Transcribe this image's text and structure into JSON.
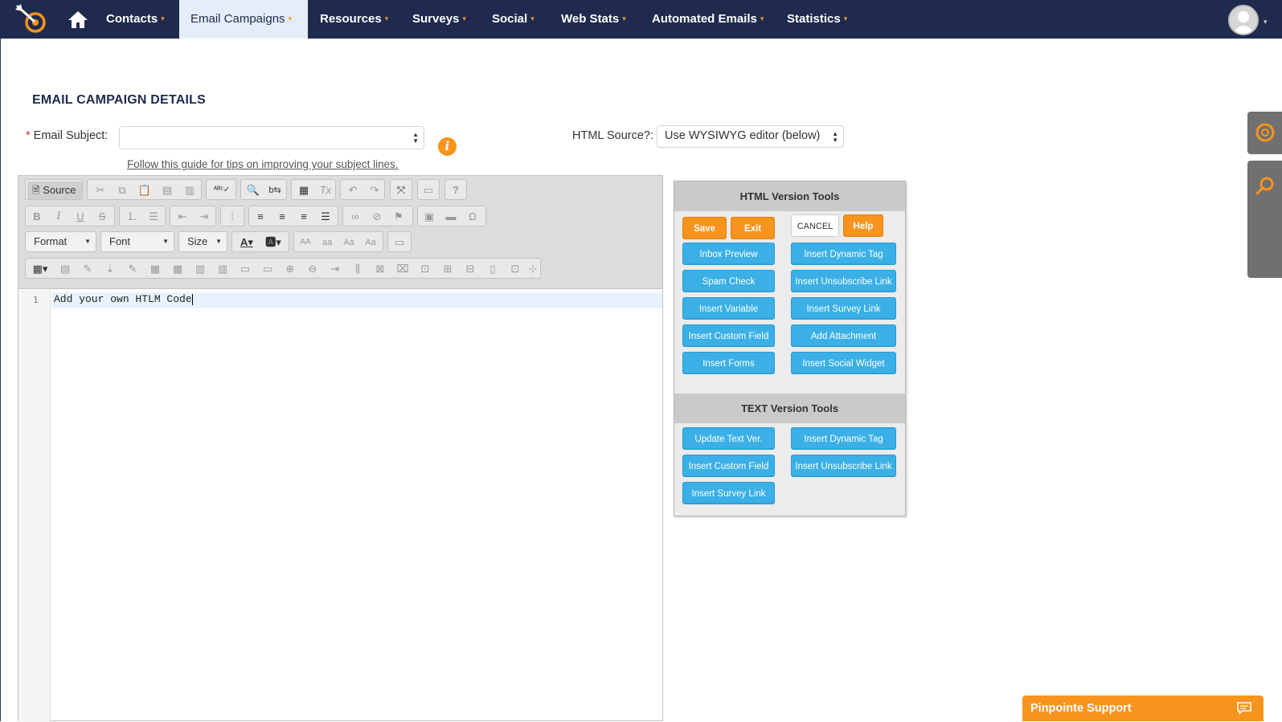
{
  "nav": {
    "items": [
      {
        "label": "Contacts",
        "active": false
      },
      {
        "label": "Email Campaigns",
        "active": true
      },
      {
        "label": "Resources",
        "active": false
      },
      {
        "label": "Surveys",
        "active": false
      },
      {
        "label": "Social",
        "active": false
      },
      {
        "label": "Web Stats",
        "active": false
      },
      {
        "label": "Automated Emails",
        "active": false
      },
      {
        "label": "Statistics",
        "active": false
      }
    ],
    "caret": "▾",
    "accent_color": "#f7941d",
    "bar_color": "#1f2a4e"
  },
  "page": {
    "title": "EMAIL CAMPAIGN DETAILS",
    "subject_label": "Email Subject:",
    "required_mark": "*",
    "subject_value": "",
    "guide_link": "Follow this guide for tips on improving your subject lines.",
    "info_glyph": "i",
    "html_source_label": "HTML Source?:",
    "html_source_value": "Use WYSIWYG editor (below)"
  },
  "editor": {
    "source_label": "Source",
    "format_label": "Format",
    "font_label": "Font",
    "size_label": "Size",
    "line_number": "1",
    "code": "Add your own HTLM Code"
  },
  "tools": {
    "html_header": "HTML Version Tools",
    "save": "Save",
    "exit": "Exit",
    "cancel": "CANCEL",
    "help": "Help",
    "html_buttons_left": [
      "Inbox Preview",
      "Spam Check",
      "Insert Variable",
      "Insert Custom Field",
      "Insert Forms"
    ],
    "html_buttons_right": [
      "Insert Dynamic Tag",
      "Insert Unsubscribe Link",
      "Insert Survey Link",
      "Add Attachment",
      "Insert Social Widget"
    ],
    "text_header": "TEXT Version Tools",
    "text_buttons_left": [
      "Update Text Ver.",
      "Insert Custom Field",
      "Insert Survey Link"
    ],
    "text_buttons_right": [
      "Insert Dynamic Tag",
      "Insert Unsubscribe Link"
    ]
  },
  "support": {
    "label": "Pinpointe Support"
  }
}
